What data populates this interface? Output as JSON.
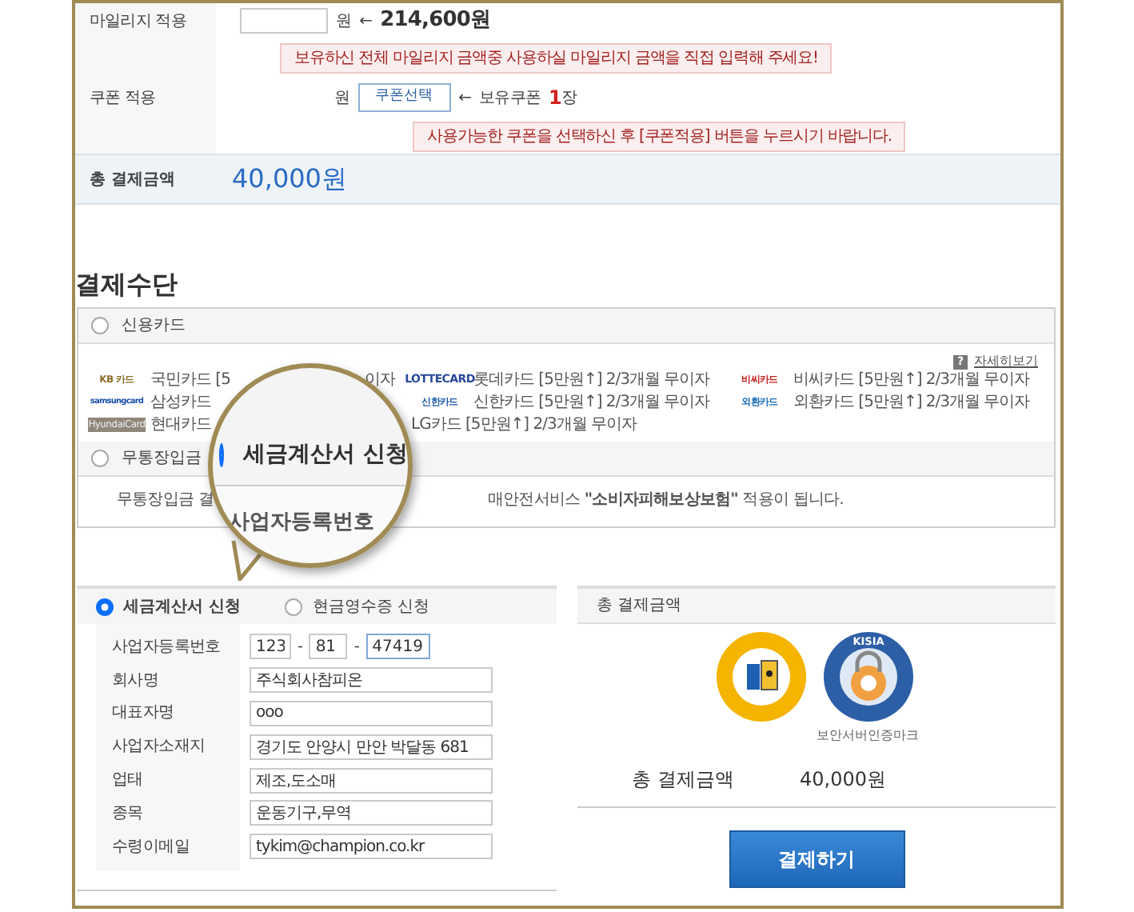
{
  "discount": {
    "mileage": {
      "label": "마일리지 적용",
      "unit": "원",
      "arrow": "←",
      "amount": "214,600원",
      "tip": "보유하신 전체 마일리지 금액중 사용하실 마일리지 금액을 직접 입력해 주세요!"
    },
    "coupon": {
      "label": "쿠폰 적용",
      "unit": "원",
      "button": "쿠폰선택",
      "arrow": "←",
      "held_label": "보유쿠폰",
      "held_count": "1",
      "held_unit": "장",
      "tip": "사용가능한 쿠폰을 선택하신 후 [쿠폰적용] 버튼을 누르시기 바랍니다."
    },
    "total": {
      "label": "총 결제금액",
      "amount": "40,000원"
    }
  },
  "payment_heading": "결제수단",
  "methods": [
    {
      "label": "신용카드",
      "selected": false
    },
    {
      "label": "무통장입금",
      "selected": false
    }
  ],
  "card_help": {
    "mark": "?",
    "link": "자세히보기"
  },
  "cards": [
    {
      "kind": "kb",
      "logo": "KB 카드",
      "text": "국민카드 [5",
      "tail": "이자"
    },
    {
      "kind": "lotte",
      "logo": "LOTTECARD",
      "text": "롯데카드 [5만원↑] 2/3개월 무이자"
    },
    {
      "kind": "bc",
      "logo": "비씨카드",
      "text": "비씨카드 [5만원↑] 2/3개월 무이자"
    },
    {
      "kind": "samsung",
      "logo": "samsungcard",
      "text": "삼성카드"
    },
    {
      "kind": "shinhan",
      "logo": "신한카드",
      "text": "신한카드 [5만원↑] 2/3개월 무이자"
    },
    {
      "kind": "keb",
      "logo": "외환카드",
      "text": "외환카드 [5만원↑] 2/3개월 무이자"
    },
    {
      "kind": "hyundai",
      "logo": "HyundaiCard",
      "text": "현대카드"
    },
    {
      "kind": "plain",
      "text": "LG카드 [5만원↑] 2/3개월 무이자"
    },
    {
      "kind": "empty"
    }
  ],
  "bank_note": {
    "left": "무통장입금 결",
    "right": "매안전서비스 **\"소비자피해보상보험\"** 적용이 됩니다."
  },
  "magnifier": {
    "option": {
      "label": "세금계산서 신청",
      "selected": true
    },
    "field_label": "사업자등록번호"
  },
  "receipt": {
    "options": [
      {
        "label": "세금계산서 신청",
        "selected": true
      },
      {
        "label": "현금영수증 신청",
        "selected": false
      }
    ],
    "fields": [
      {
        "kind": "triple",
        "label": "사업자등록번호",
        "values": [
          "123",
          "81",
          "47419"
        ],
        "separators": [
          "-",
          "-"
        ]
      },
      {
        "kind": "text",
        "label": "회사명",
        "value": "주식회사참피온"
      },
      {
        "kind": "text",
        "label": "대표자명",
        "value": "ooo"
      },
      {
        "kind": "text",
        "label": "사업자소재지",
        "value": "경기도 안양시 만안 박달동 681"
      },
      {
        "kind": "text",
        "label": "업태",
        "value": "제조,도소매"
      },
      {
        "kind": "text",
        "label": "종목",
        "value": "운동기구,무역"
      },
      {
        "kind": "text",
        "label": "수령이메일",
        "value": "tykim@champion.co.kr"
      }
    ]
  },
  "summary": {
    "title": "총 결제금액",
    "badge_text": "KISIA",
    "badge_caption": "보안서버인증마크",
    "total_label": "총 결제금액",
    "total_amount": "40,000원",
    "pay_button": "결제하기"
  }
}
